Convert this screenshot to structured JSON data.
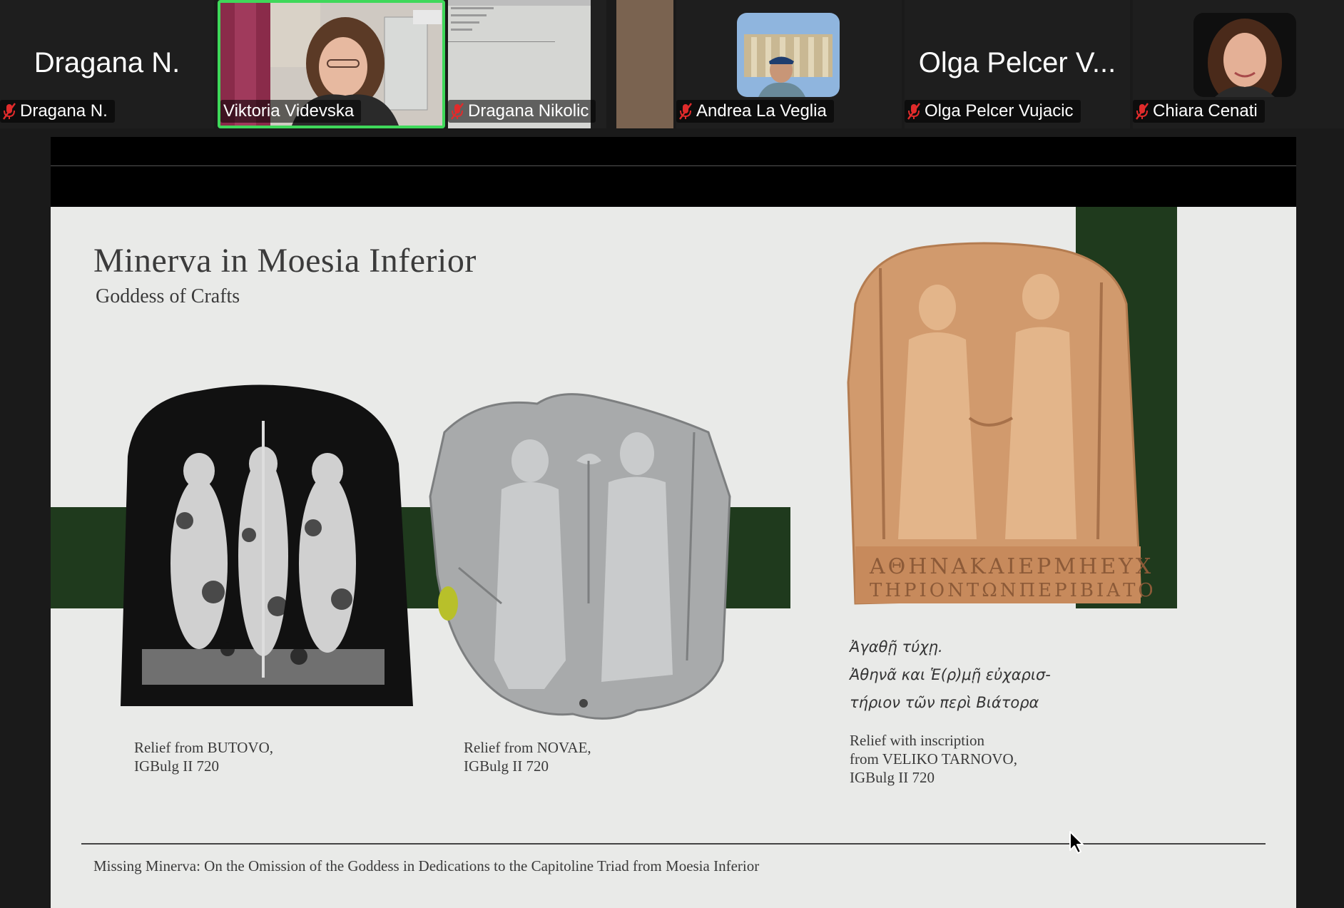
{
  "participants": [
    {
      "big_name": "Dragana N.",
      "label": "Dragana N.",
      "muted": true,
      "video": false
    },
    {
      "big_name": "",
      "label": "Viktoria Videvska",
      "muted": false,
      "video": true,
      "active_speaker": true
    },
    {
      "big_name": "",
      "label": "Dragana Nikolic",
      "muted": true,
      "video": true
    },
    {
      "big_name": "",
      "label": "Andrea La Veglia",
      "muted": true,
      "video": true
    },
    {
      "big_name": "Olga Pelcer V...",
      "label": "Olga Pelcer Vujacic",
      "muted": true,
      "video": false
    },
    {
      "big_name": "",
      "label": "Chiara Cenati",
      "muted": true,
      "video": true
    }
  ],
  "slide": {
    "title": "Minerva in Moesia Inferior",
    "subtitle": "Goddess of Crafts",
    "reliefs": [
      {
        "caption_line1": "Relief from BUTOVO,",
        "caption_line2": "IGBulg II 720"
      },
      {
        "caption_line1": "Relief from NOVAE,",
        "caption_line2": "IGBulg II 720"
      },
      {
        "caption_line1": "Relief with inscription",
        "caption_line2": "from VELIKO TARNOVO,",
        "caption_line3": "IGBulg II 720"
      }
    ],
    "inscription": [
      "Ἀγαθῇ τύχῃ.",
      "Ἀθηνᾶ και Ἑ(ρ)μῇ εὐχαρισ-",
      "τήριον τῶν περὶ Βιάτορα"
    ],
    "footer": "Missing Minerva: On the Omission of the Goddess in Dedications to the Capitoline Triad from Moesia Inferior"
  },
  "colors": {
    "slide_background": "#e9eae8",
    "green_band": "#1f3a1d",
    "active_speaker_border": "#3fd85a",
    "mute_icon": "#e02b2b"
  }
}
